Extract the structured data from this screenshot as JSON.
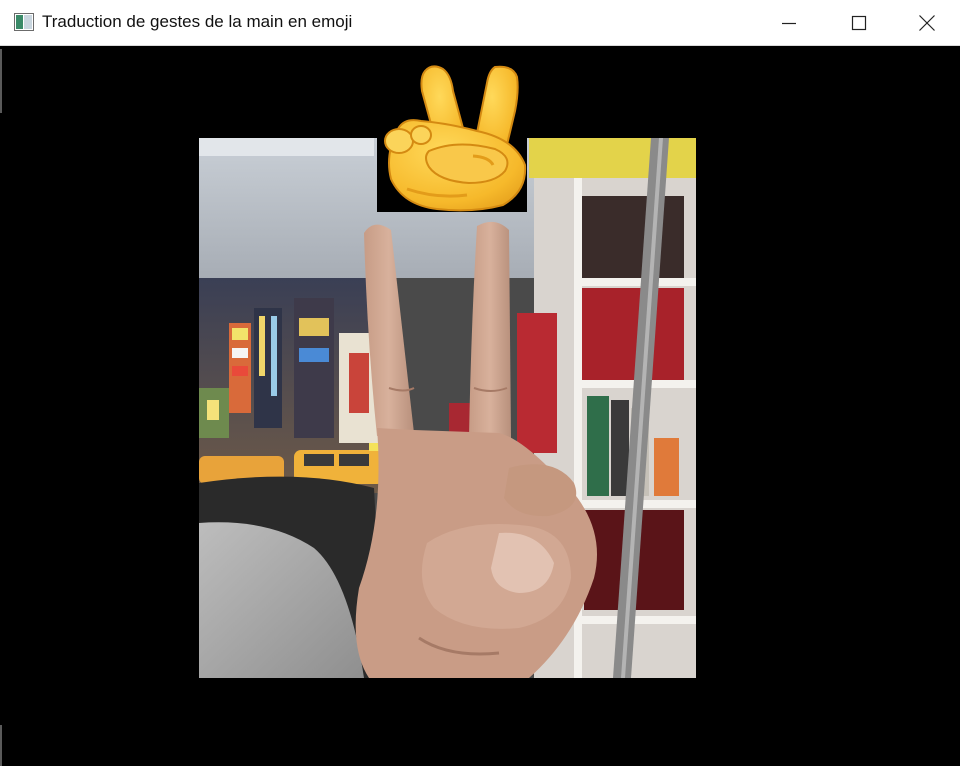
{
  "window": {
    "title": "Traduction de gestes de la main en emoji",
    "controls": [
      "minimize-icon",
      "maximize-icon",
      "close-icon"
    ]
  },
  "video": {
    "subject": "victory-hand-gesture",
    "overlay_emoji": "✌️"
  },
  "colors": {
    "titlebar_bg": "#ffffff",
    "canvas_bg": "#000000",
    "emoji_yellow": "#f5c23a"
  }
}
